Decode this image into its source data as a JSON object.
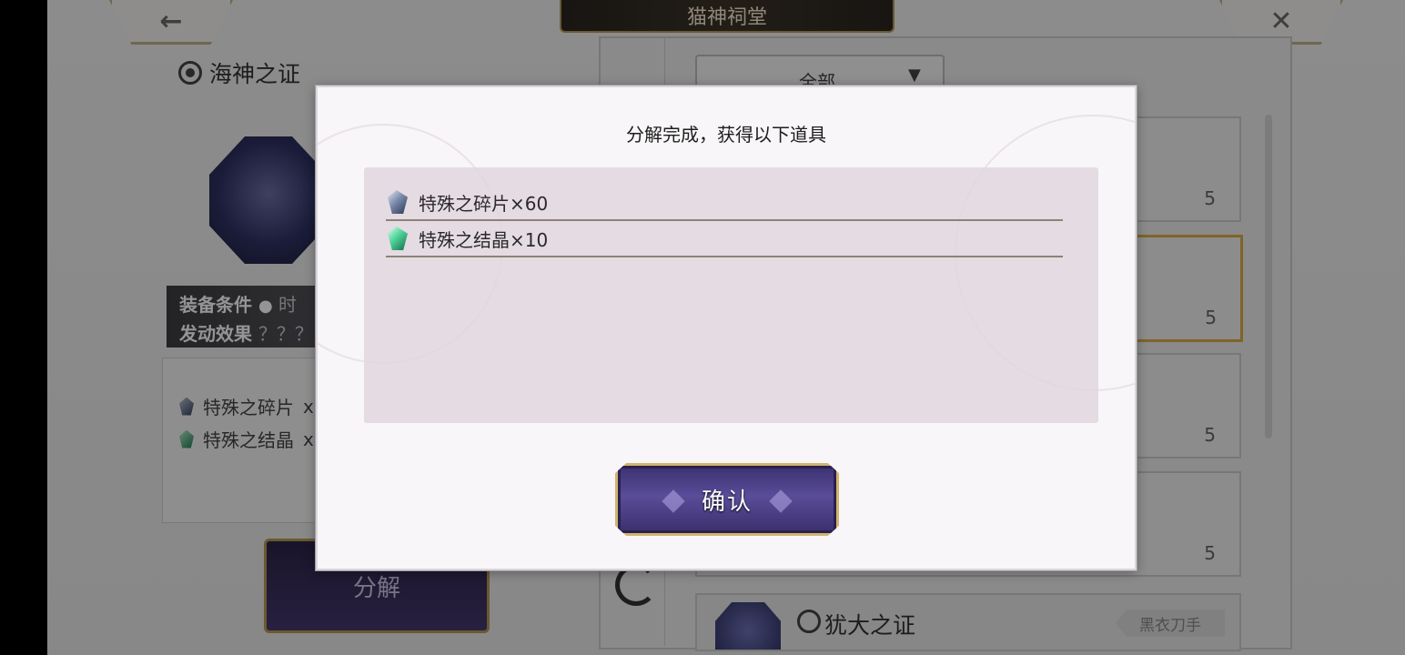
{
  "background": {
    "header_title": "猫神祠堂",
    "back_icon": "left-arrow-icon",
    "close_icon": "close-icon",
    "item_title": "海神之证",
    "condition_line1": "装备条件",
    "condition_line1_extra": "时",
    "condition_line2": "发动效果",
    "condition_line2_extra": "？？？",
    "drops": [
      {
        "name": "特殊之碎片",
        "suffix": "x"
      },
      {
        "name": "特殊之结晶",
        "suffix": "x"
      }
    ],
    "decompose_label": "分解",
    "filter_label": "全部",
    "filter_arrow": "▼",
    "list_counts": [
      "5",
      "5",
      "5",
      "5"
    ],
    "bottom_item_name": "犹大之证",
    "bottom_item_tag": "黑衣刀手"
  },
  "modal": {
    "title": "分解完成，获得以下道具",
    "rewards": [
      {
        "name": "特殊之碎片×60",
        "icon": "shard-icon"
      },
      {
        "name": "特殊之结晶×10",
        "icon": "crystal-icon"
      }
    ],
    "confirm_label": "确认"
  },
  "colors": {
    "accent_gold": "#d1b46d",
    "button_purple": "#4a3d88",
    "modal_bg": "#f8f6f8"
  }
}
